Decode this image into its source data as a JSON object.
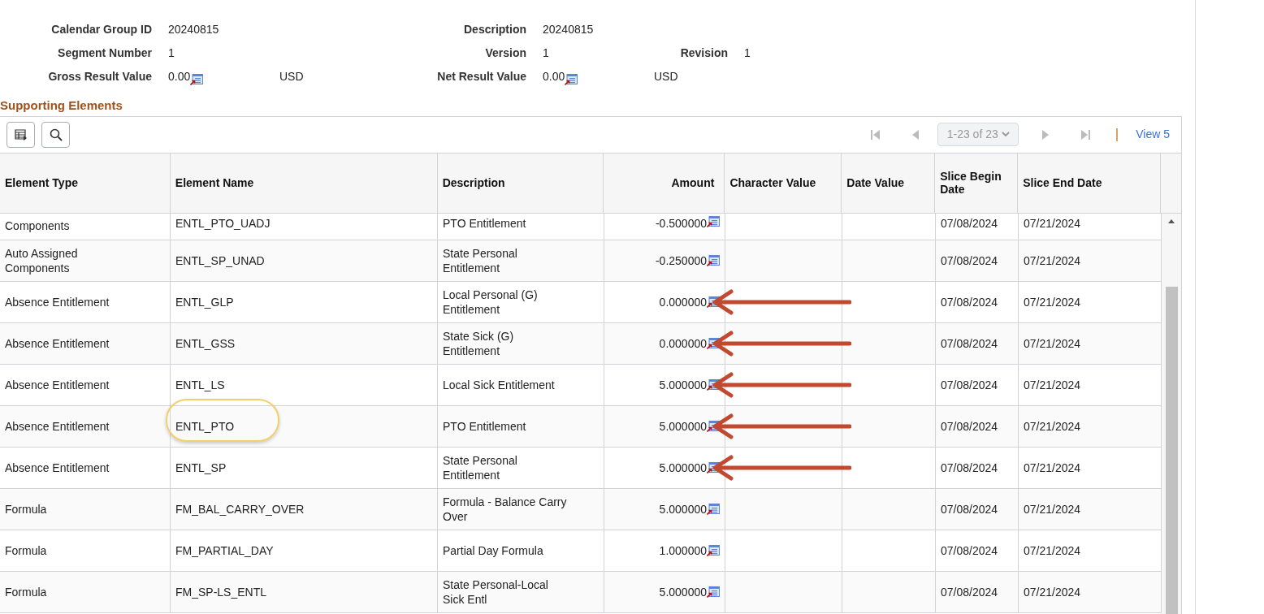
{
  "summary": {
    "calendar_group_id": {
      "label": "Calendar Group ID",
      "value": "20240815"
    },
    "description": {
      "label": "Description",
      "value": "20240815"
    },
    "segment_number": {
      "label": "Segment Number",
      "value": "1"
    },
    "version": {
      "label": "Version",
      "value": "1"
    },
    "revision": {
      "label": "Revision",
      "value": "1"
    },
    "gross_result": {
      "label": "Gross Result Value",
      "value": "0.00",
      "currency": "USD"
    },
    "net_result": {
      "label": "Net Result Value",
      "value": "0.00",
      "currency": "USD"
    }
  },
  "section_title": "Supporting Elements",
  "pagination": {
    "range": "1-23 of 23",
    "view_link": "View 5"
  },
  "table": {
    "columns": [
      "Element Type",
      "Element Name",
      "Description",
      "Amount",
      "Character Value",
      "Date Value",
      "Slice Begin Date",
      "Slice End Date"
    ],
    "rows": [
      {
        "element_type": "Components",
        "element_name": "ENTL_PTO_UADJ",
        "description": "PTO Entitlement",
        "amount": "-0.500000",
        "slice_begin": "07/08/2024",
        "slice_end": "07/21/2024",
        "arrow": false,
        "highlighted": false
      },
      {
        "element_type": "Auto Assigned Components",
        "element_name": "ENTL_SP_UNAD",
        "description": "State Personal Entitlement",
        "amount": "-0.250000",
        "slice_begin": "07/08/2024",
        "slice_end": "07/21/2024",
        "arrow": false,
        "highlighted": false
      },
      {
        "element_type": "Absence Entitlement",
        "element_name": "ENTL_GLP",
        "description": "Local Personal (G) Entitlement",
        "amount": "0.000000",
        "slice_begin": "07/08/2024",
        "slice_end": "07/21/2024",
        "arrow": true,
        "highlighted": false
      },
      {
        "element_type": "Absence Entitlement",
        "element_name": "ENTL_GSS",
        "description": "State Sick (G) Entitlement",
        "amount": "0.000000",
        "slice_begin": "07/08/2024",
        "slice_end": "07/21/2024",
        "arrow": true,
        "highlighted": false
      },
      {
        "element_type": "Absence Entitlement",
        "element_name": "ENTL_LS",
        "description": "Local Sick Entitlement",
        "amount": "5.000000",
        "slice_begin": "07/08/2024",
        "slice_end": "07/21/2024",
        "arrow": true,
        "highlighted": false
      },
      {
        "element_type": "Absence Entitlement",
        "element_name": "ENTL_PTO",
        "description": "PTO Entitlement",
        "amount": "5.000000",
        "slice_begin": "07/08/2024",
        "slice_end": "07/21/2024",
        "arrow": true,
        "highlighted": true
      },
      {
        "element_type": "Absence Entitlement",
        "element_name": "ENTL_SP",
        "description": "State Personal Entitlement",
        "amount": "5.000000",
        "slice_begin": "07/08/2024",
        "slice_end": "07/21/2024",
        "arrow": true,
        "highlighted": false
      },
      {
        "element_type": "Formula",
        "element_name": "FM_BAL_CARRY_OVER",
        "description": "Formula - Balance Carry Over",
        "amount": "5.000000",
        "slice_begin": "07/08/2024",
        "slice_end": "07/21/2024",
        "arrow": false,
        "highlighted": false
      },
      {
        "element_type": "Formula",
        "element_name": "FM_PARTIAL_DAY",
        "description": "Partial Day Formula",
        "amount": "1.000000",
        "slice_begin": "07/08/2024",
        "slice_end": "07/21/2024",
        "arrow": false,
        "highlighted": false
      },
      {
        "element_type": "Formula",
        "element_name": "FM_SP-LS_ENTL",
        "description": "State Personal-Local Sick Entl",
        "amount": "5.000000",
        "slice_begin": "07/08/2024",
        "slice_end": "07/21/2024",
        "arrow": false,
        "highlighted": false
      }
    ]
  }
}
